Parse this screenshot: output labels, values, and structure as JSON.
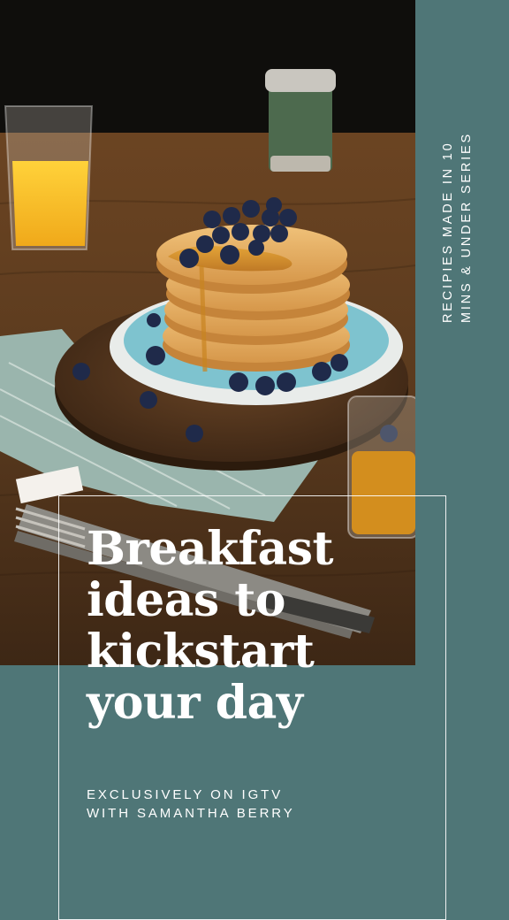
{
  "colors": {
    "background": "#4f7677",
    "text": "#ffffff"
  },
  "series": {
    "line1": "RECIPIES MADE IN 10",
    "line2": "MINS & UNDER SERIES"
  },
  "headline": {
    "line1": "Breakfast",
    "line2": "ideas to",
    "line3": "kickstart",
    "line4": "your day"
  },
  "subline": {
    "line1": "EXCLUSIVELY ON IGTV",
    "line2": "WITH SAMANTHA BERRY"
  }
}
